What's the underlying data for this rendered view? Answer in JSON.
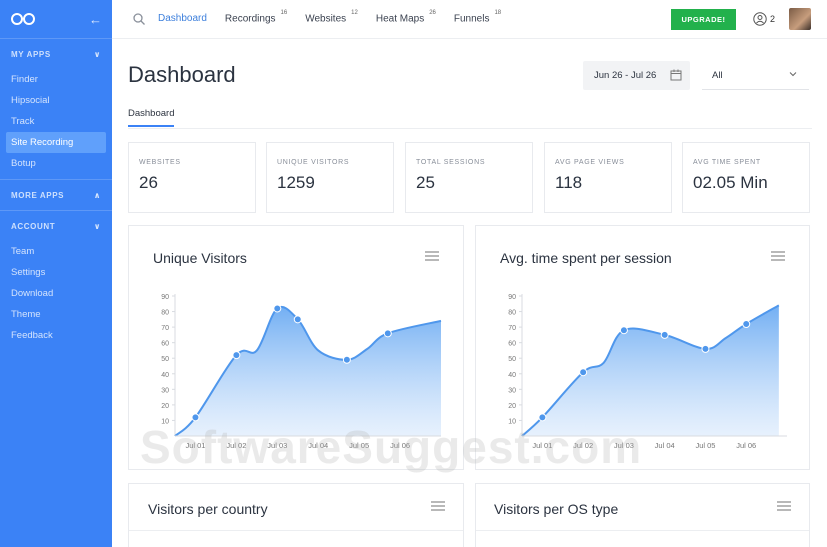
{
  "sidebar": {
    "back_icon": "arrow-left-icon",
    "sections": [
      {
        "title": "MY APPS",
        "items": [
          "Finder",
          "Hipsocial",
          "Track",
          "Site Recording",
          "Botup"
        ]
      },
      {
        "title": "MORE APPS",
        "items": []
      },
      {
        "title": "ACCOUNT",
        "items": [
          "Team",
          "Settings",
          "Download",
          "Theme",
          "Feedback"
        ]
      }
    ],
    "active_item": "Site Recording"
  },
  "topbar": {
    "nav": [
      {
        "label": "Dashboard",
        "count": ""
      },
      {
        "label": "Recordings",
        "count": "16"
      },
      {
        "label": "Websites",
        "count": "12"
      },
      {
        "label": "Heat Maps",
        "count": "26"
      },
      {
        "label": "Funnels",
        "count": "18"
      }
    ],
    "upgrade_label": "UPGRADE!",
    "user_count": "2"
  },
  "header": {
    "title": "Dashboard",
    "date_range": "Jun 26 - Jul 26",
    "filter_value": "All",
    "tab": "Dashboard"
  },
  "stats": [
    {
      "label": "WEBSITES",
      "value": "26"
    },
    {
      "label": "UNIQUE VISITORS",
      "value": "1259"
    },
    {
      "label": "TOTAL SESSIONS",
      "value": "25"
    },
    {
      "label": "AVG PAGE VIEWS",
      "value": "118"
    },
    {
      "label": "AVG TIME SPENT",
      "value": "02.05 Min"
    }
  ],
  "cards": {
    "visitors_country": "Visitors per country",
    "visitors_os": "Visitors per OS type"
  },
  "watermark": "SoftwareSuggest.com",
  "colors": {
    "sidebar": "#3b82f6",
    "accent": "#3d7fdc",
    "upgrade": "#22b14c",
    "line": "#4f97ec"
  },
  "chart_data": [
    {
      "type": "area",
      "title": "Unique Visitors",
      "categories": [
        "Jul 01",
        "Jul 02",
        "Jul 03",
        "Jul 04",
        "Jul 05",
        "Jul 06"
      ],
      "x": [
        0,
        0.5,
        1,
        1.5,
        2,
        2.5,
        3,
        3.5,
        4,
        4.5,
        5,
        5.5,
        6
      ],
      "points_x": [
        0.5,
        1.5,
        2.5,
        3,
        4.2,
        5.2
      ],
      "points_y": [
        12,
        52,
        82,
        75,
        49,
        66
      ],
      "curve_y": [
        0,
        12,
        52,
        55,
        82,
        75,
        55,
        49,
        56,
        66,
        74
      ],
      "curve_x": [
        0,
        0.5,
        1.5,
        2,
        2.5,
        3,
        3.5,
        4.2,
        4.7,
        5.2,
        6.5
      ],
      "ylim": [
        0,
        90
      ],
      "yticks": [
        10,
        20,
        30,
        40,
        50,
        60,
        70,
        80,
        90
      ]
    },
    {
      "type": "area",
      "title": "Avg. time spent per session",
      "categories": [
        "Jul 01",
        "Jul 02",
        "Jul 03",
        "Jul 04",
        "Jul 05",
        "Jul 06"
      ],
      "points_x": [
        0.5,
        1.5,
        2.5,
        3.5,
        4.5,
        5.5
      ],
      "points_y": [
        12,
        41,
        68,
        65,
        56,
        72
      ],
      "curve_y": [
        0,
        12,
        41,
        47,
        68,
        65,
        56,
        63,
        72,
        84
      ],
      "curve_x": [
        0,
        0.5,
        1.5,
        2,
        2.5,
        3.5,
        4.5,
        5,
        5.5,
        6.3
      ],
      "ylim": [
        0,
        90
      ],
      "yticks": [
        10,
        20,
        30,
        40,
        50,
        60,
        70,
        80,
        90
      ]
    }
  ]
}
